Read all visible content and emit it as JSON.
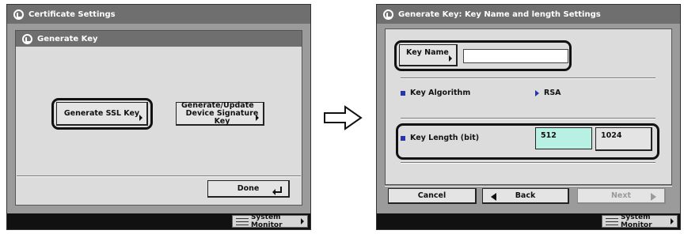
{
  "left_screen": {
    "title": "Certificate Settings",
    "panel_title": "Generate Key",
    "generate_ssl_key_label": "Generate SSL Key",
    "generate_update_line1": "Generate/Update",
    "generate_update_line2": "Device Signature Key",
    "done_label": "Done",
    "system_monitor_label": "System Monitor"
  },
  "right_screen": {
    "title": "Generate Key: Key Name and length Settings",
    "key_name_button_label": "Key Name",
    "key_name_value": "",
    "key_algorithm_label": "Key Algorithm",
    "key_algorithm_value": "RSA",
    "key_length_label": "Key Length (bit)",
    "key_length_options": [
      "512",
      "1024"
    ],
    "key_length_selected": "512",
    "cancel_label": "Cancel",
    "back_label": "Back",
    "next_label": "Next",
    "system_monitor_label": "System Monitor"
  },
  "colors": {
    "selected_option": "#b8f0e4",
    "bullet_blue": "#2436a8",
    "titlebar_gray": "#6f6f6f"
  },
  "icons": {
    "transition_arrow": "arrow-right-outline-icon",
    "app_icon": "settings-app-icon",
    "system_monitor_icon": "system-monitor-icon"
  }
}
